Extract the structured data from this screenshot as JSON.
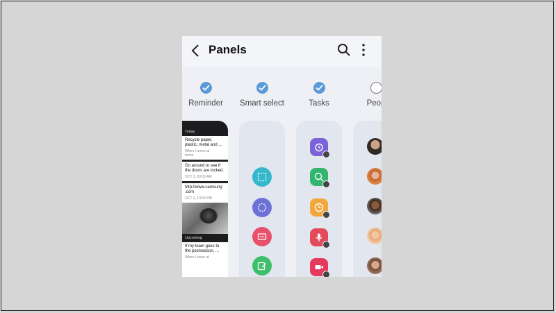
{
  "appbar": {
    "title": "Panels"
  },
  "icons": {
    "back": "chevron-left-icon",
    "search": "search-icon",
    "more": "more-vert-icon"
  },
  "panels": [
    {
      "label": "Reminder",
      "checked": true
    },
    {
      "label": "Smart select",
      "checked": true
    },
    {
      "label": "Tasks",
      "checked": true
    },
    {
      "label": "Peop",
      "checked": false
    }
  ],
  "reminder": {
    "today_header": "Today",
    "items": [
      {
        "title": "Recycle paper, plastic, metal and ...",
        "meta1": "When I arrive at",
        "meta2": "home"
      },
      {
        "title": "Go around to see if the doors are locked.",
        "meta1": "OCT 2, 00:00 AM",
        "meta2": ""
      },
      {
        "title": "http://www.samsung .com",
        "meta1": "OCT 2, 14:00 PM",
        "meta2": ""
      }
    ],
    "upcoming_header": "Upcoming",
    "upcoming_item": {
      "title": "If my team goes to the postseason, ...",
      "meta1": "When I leave at"
    }
  },
  "colors": {
    "accent_check": "#5b9ad6",
    "smart_select_1": "#35b7cc",
    "smart_select_2": "#6c72d6",
    "smart_select_3": "#e8516b",
    "smart_select_4": "#3fbf6c",
    "task_1": "#7b62d6",
    "task_2": "#33b56e",
    "task_3": "#f2a73a",
    "task_4": "#e34a5a",
    "task_5": "#e43a5c"
  }
}
